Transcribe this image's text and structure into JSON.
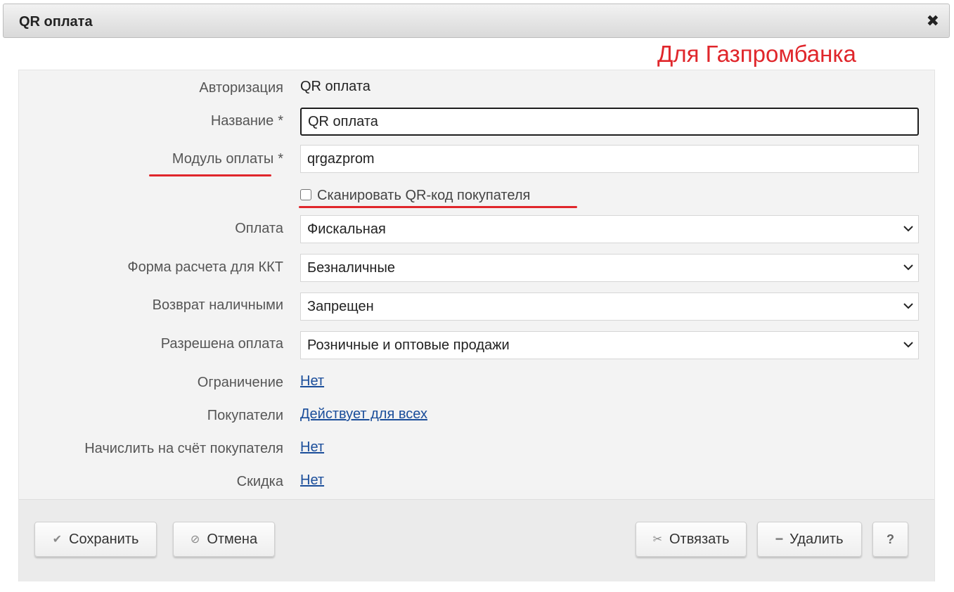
{
  "dialog": {
    "title": "QR оплата",
    "close_glyph": "✖"
  },
  "annotation": {
    "text": "Для Газпромбанка",
    "color": "#e0262b"
  },
  "form": {
    "authorization": {
      "label": "Авторизация",
      "value": "QR оплата"
    },
    "name": {
      "label": "Название",
      "required": "*",
      "value": "QR оплата"
    },
    "module": {
      "label": "Модуль оплаты",
      "required": "*",
      "value": "qrgazprom"
    },
    "scan_qr": {
      "label": "Сканировать QR-код покупателя",
      "checked": false
    },
    "payment": {
      "label": "Оплата",
      "value": "Фискальная"
    },
    "kkt_form": {
      "label": "Форма расчета для ККТ",
      "value": "Безналичные"
    },
    "cash_return": {
      "label": "Возврат наличными",
      "value": "Запрещен"
    },
    "allowed_payment": {
      "label": "Разрешена оплата",
      "value": "Розничные и оптовые продажи"
    },
    "restriction": {
      "label": "Ограничение",
      "value": "Нет"
    },
    "buyers": {
      "label": "Покупатели",
      "value": "Действует для всех"
    },
    "credit_account": {
      "label": "Начислить на счёт покупателя",
      "value": "Нет"
    },
    "discount": {
      "label": "Скидка",
      "value": "Нет"
    }
  },
  "footer": {
    "save": {
      "label": "Сохранить",
      "icon": "check-icon"
    },
    "cancel": {
      "label": "Отмена",
      "icon": "cancel-icon"
    },
    "unbind": {
      "label": "Отвязать",
      "icon": "scissors-icon"
    },
    "delete": {
      "label": "Удалить",
      "icon": "minus-icon"
    },
    "help": {
      "label": "?"
    }
  },
  "colors": {
    "link": "#1a4d9a",
    "annotation_underline": "#e0262b",
    "panel_bg": "#f3f3f3"
  }
}
